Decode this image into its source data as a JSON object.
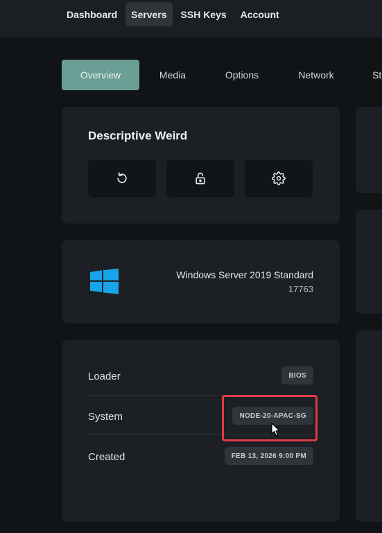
{
  "topnav": {
    "items": [
      {
        "label": "Dashboard",
        "active": false
      },
      {
        "label": "Servers",
        "active": true
      },
      {
        "label": "SSH Keys",
        "active": false
      },
      {
        "label": "Account",
        "active": false
      }
    ]
  },
  "tabs": {
    "items": [
      {
        "label": "Overview",
        "active": true
      },
      {
        "label": "Media",
        "active": false
      },
      {
        "label": "Options",
        "active": false
      },
      {
        "label": "Network",
        "active": false
      },
      {
        "label": "St",
        "active": false
      }
    ]
  },
  "server": {
    "name": "Descriptive Weird",
    "actions": [
      {
        "icon": "restart-icon"
      },
      {
        "icon": "unlock-icon"
      },
      {
        "icon": "gear-icon"
      }
    ]
  },
  "os": {
    "icon": "windows-logo-icon",
    "name": "Windows Server 2019 Standard",
    "build": "17763"
  },
  "details": {
    "rows": [
      {
        "label": "Loader",
        "value": "BIOS"
      },
      {
        "label": "System",
        "value": "NODE-20-APAC-SG"
      },
      {
        "label": "Created",
        "value": "FEB 13, 2026 9:00 PM"
      }
    ]
  },
  "colors": {
    "accent": "#6b9e94",
    "background": "#111417",
    "card": "#1c2024",
    "highlight": "#e23a44"
  }
}
